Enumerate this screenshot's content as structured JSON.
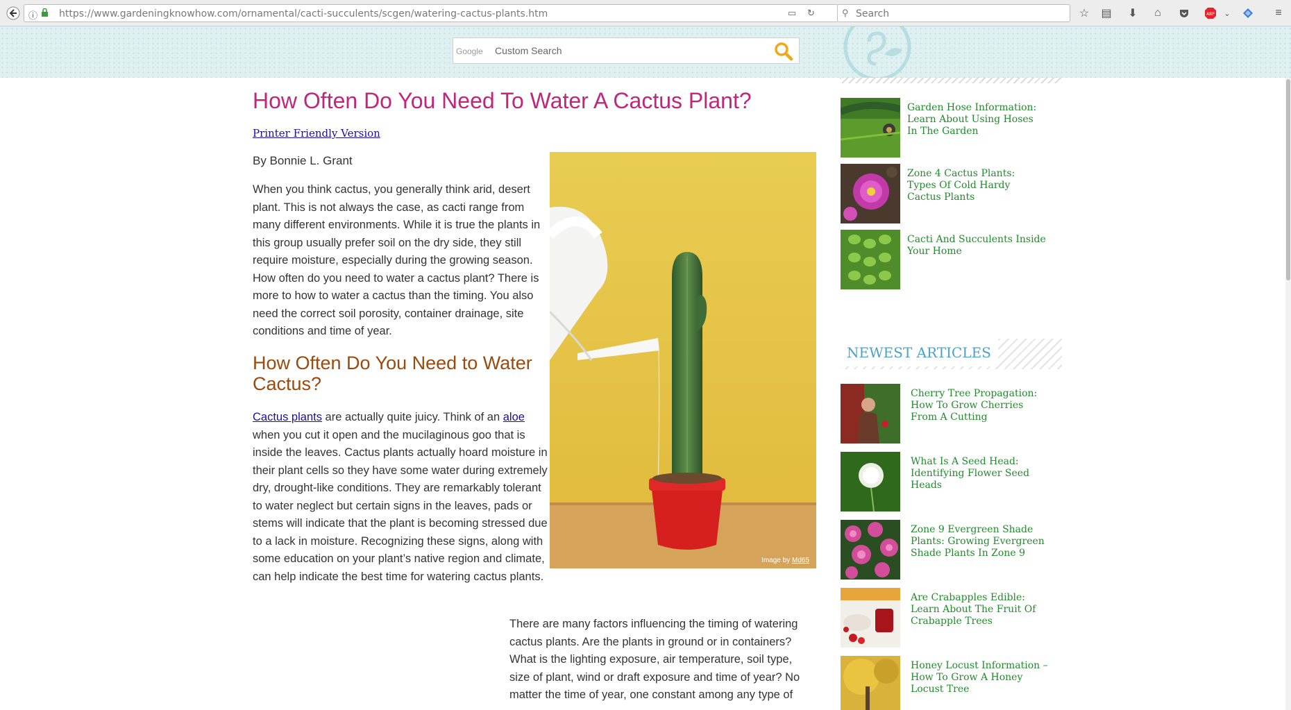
{
  "browser": {
    "url_host": "https://www.gardeningknowhow.com",
    "url_path": "/ornamental/cacti-succulents/scgen/watering-cactus-plants.htm",
    "search_placeholder": "Search"
  },
  "site_search": {
    "brand": "Google",
    "placeholder": "Custom Search"
  },
  "article": {
    "title": "How Often Do You Need To Water A Cactus Plant?",
    "printer_link": "Printer Friendly Version",
    "byline": "By Bonnie L. Grant",
    "p1": "When you think cactus, you generally think arid, desert plant. This is not always the case, as cacti range from many different environments. While it is true the plants in this group usually prefer soil on the dry side, they still require moisture, especially during the growing season. How often do you need to water a cactus plant? There is more to how to water a cactus than the timing. You also need the correct soil porosity, container drainage, site conditions and time of year.",
    "h2": "How Often Do You Need to Water Cactus?",
    "p2_link1": "Cactus plants",
    "p2_mid": " are actually quite juicy. Think of an ",
    "p2_link2": "aloe",
    "p2_rest": " when you cut it open and the mucilaginous goo that is inside the leaves. Cactus plants actually hoard moisture in their plant cells so they have some water during extremely dry, drought-like conditions. They are remarkably tolerant to water neglect but certain signs in the leaves, pads or stems will indicate that the plant is becoming stressed due to a lack in moisture. Recognizing these signs, along with some education on your plant’s native region and climate, can help indicate the best time for watering cactus plants.",
    "p3": "There are many factors influencing the timing of watering cactus plants. Are the plants in ground or in containers? What is the lighting exposure, air temperature, soil type, size of plant, wind or draft exposure and time of year? No matter the time of year, one constant among any type of",
    "image_credit_prefix": "Image by ",
    "image_credit_author": "Md65"
  },
  "sidebar": {
    "related": [
      {
        "title": "Garden Hose Information: Learn About Using Hoses In The Garden"
      },
      {
        "title": "Zone 4 Cactus Plants: Types Of Cold Hardy Cactus Plants"
      },
      {
        "title": "Cacti And Succulents Inside Your Home"
      }
    ],
    "newest_heading": "NEWEST ARTICLES",
    "newest": [
      {
        "title": "Cherry Tree Propagation: How To Grow Cherries From A Cutting"
      },
      {
        "title": "What Is A Seed Head: Identifying Flower Seed Heads"
      },
      {
        "title": "Zone 9 Evergreen Shade Plants: Growing Evergreen Shade Plants In Zone 9"
      },
      {
        "title": "Are Crabapples Edible: Learn About The Fruit Of Crabapple Trees"
      },
      {
        "title": "Honey Locust Information – How To Grow A Honey Locust Tree"
      }
    ]
  },
  "colors": {
    "title": "#c0267a",
    "subheading": "#9a4a0c",
    "sidebar_link": "#238a2c",
    "newest_heading": "#4aa3c7",
    "header_bg": "#dff0f1"
  }
}
